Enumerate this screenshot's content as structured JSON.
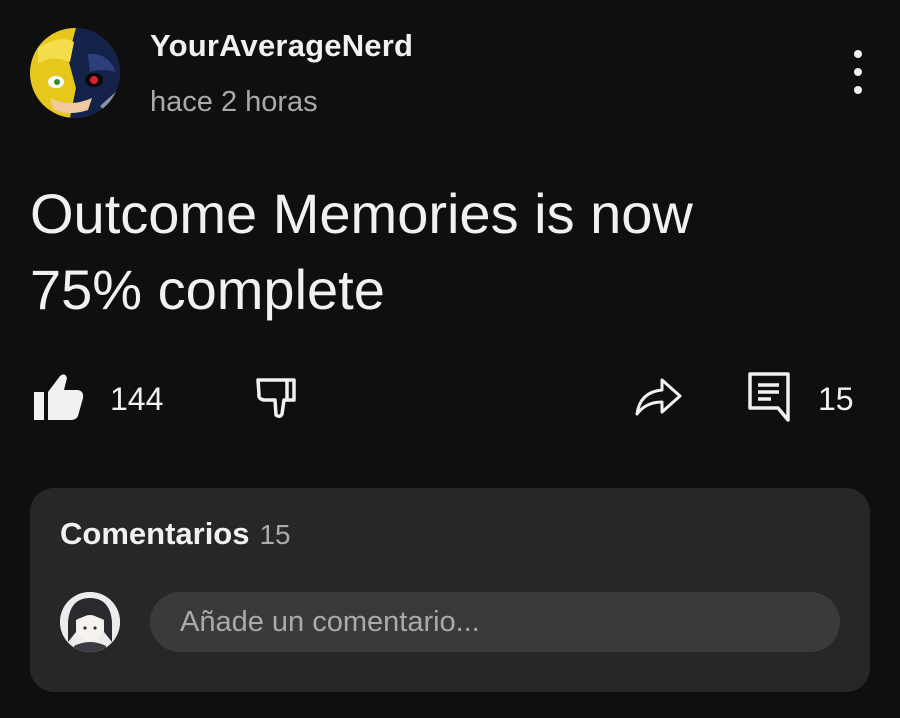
{
  "post": {
    "channel_name": "YourAverageNerd",
    "time_ago": "hace 2 horas",
    "text_line1": "Outcome Memories is now",
    "text_line2": "75% complete"
  },
  "actions": {
    "like_count": "144",
    "comments_count": "15"
  },
  "comments": {
    "title": "Comentarios",
    "count": "15",
    "input_placeholder": "Añade un comentario..."
  },
  "icons": {
    "menu": "more-vert-icon",
    "like": "thumbs-up-icon",
    "dislike": "thumbs-down-icon",
    "share": "share-icon",
    "comment": "comment-icon"
  },
  "colors": {
    "background": "#0f0f0f",
    "panel": "#272727",
    "input": "#3a3a3a",
    "text": "#f1f1f1",
    "muted": "#aaaaaa"
  }
}
